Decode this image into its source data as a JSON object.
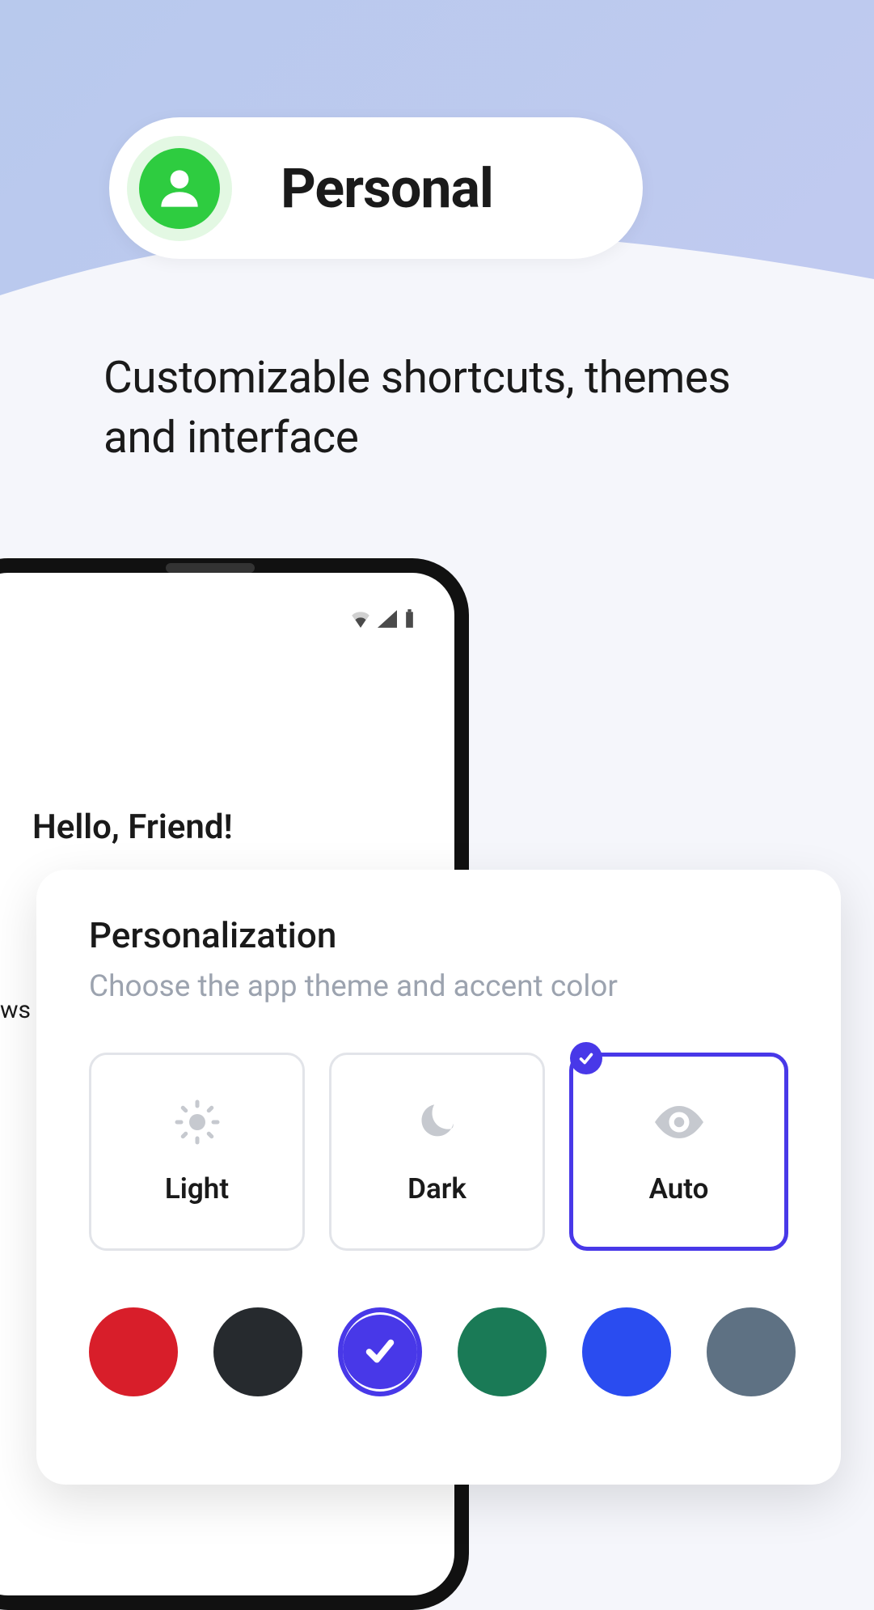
{
  "badge": {
    "label": "Personal",
    "icon_name": "person-icon"
  },
  "subtitle": "Customizable shortcuts, themes and interface",
  "phone": {
    "greeting": "Hello, Friend!",
    "truncated_text": "ws"
  },
  "card": {
    "title": "Personalization",
    "subtitle": "Choose the app theme and accent color",
    "themes": [
      {
        "id": "light",
        "label": "Light",
        "icon": "sun-icon",
        "selected": false
      },
      {
        "id": "dark",
        "label": "Dark",
        "icon": "moon-icon",
        "selected": false
      },
      {
        "id": "auto",
        "label": "Auto",
        "icon": "eye-icon",
        "selected": true
      }
    ],
    "colors": [
      {
        "name": "red",
        "hex": "#d81e2a",
        "selected": false
      },
      {
        "name": "black",
        "hex": "#262a2e",
        "selected": false
      },
      {
        "name": "purple",
        "hex": "#4838e8",
        "selected": true
      },
      {
        "name": "green",
        "hex": "#1a7a56",
        "selected": false
      },
      {
        "name": "blue",
        "hex": "#2a4cf0",
        "selected": false
      },
      {
        "name": "slate",
        "hex": "#5e7183",
        "selected": false
      }
    ],
    "accent": "#4838e8"
  }
}
